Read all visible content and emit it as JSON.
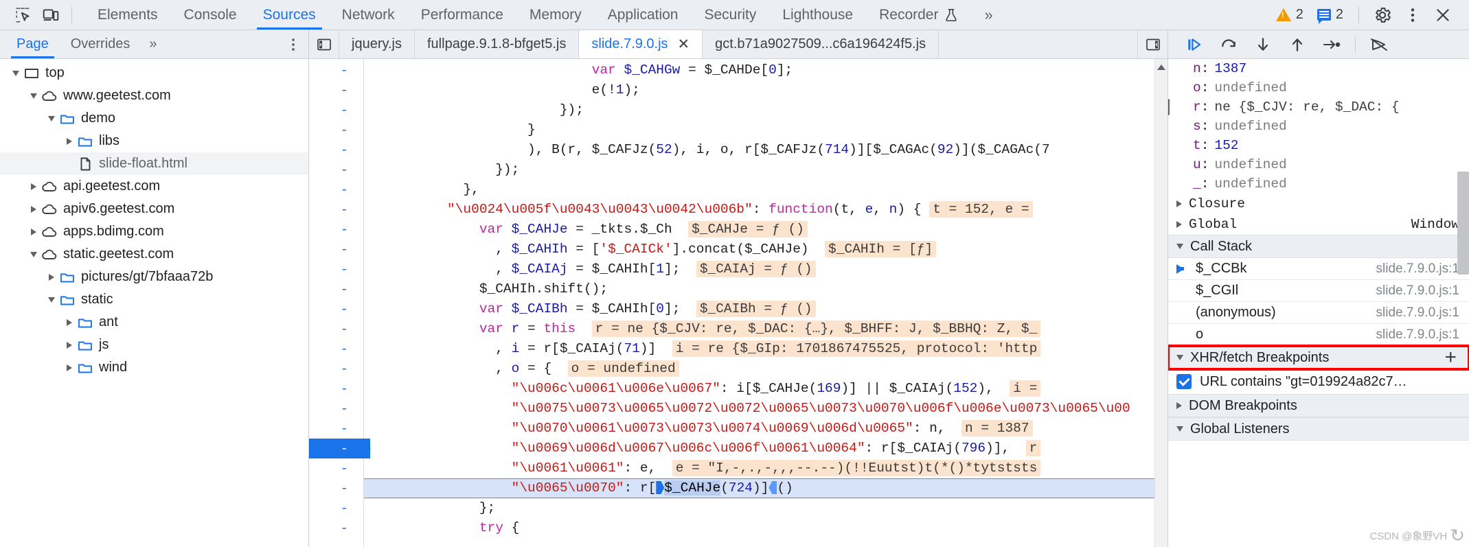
{
  "toolbar": {
    "inspect_icon": "inspect-element-icon",
    "device_icon": "device-toolbar-icon",
    "panels": [
      {
        "label": "Elements",
        "active": false
      },
      {
        "label": "Console",
        "active": false
      },
      {
        "label": "Sources",
        "active": true
      },
      {
        "label": "Network",
        "active": false
      },
      {
        "label": "Performance",
        "active": false
      },
      {
        "label": "Memory",
        "active": false
      },
      {
        "label": "Application",
        "active": false
      },
      {
        "label": "Security",
        "active": false
      },
      {
        "label": "Lighthouse",
        "active": false
      },
      {
        "label": "Recorder",
        "active": false,
        "flask": true
      }
    ],
    "more_panels": "»",
    "warning_count": "2",
    "message_count": "2",
    "settings_icon": "gear-icon",
    "kebab_icon": "more-options-icon",
    "close_icon": "close-icon"
  },
  "navigator": {
    "tabs": [
      {
        "label": "Page",
        "active": true
      },
      {
        "label": "Overrides",
        "active": false
      }
    ],
    "more": "»",
    "kebab_icon": "more-options-icon",
    "tree": [
      {
        "label": "top",
        "indent": 0,
        "twisty": "down",
        "icon": "frame",
        "selected": false
      },
      {
        "label": "www.geetest.com",
        "indent": 1,
        "twisty": "down",
        "icon": "cloud",
        "selected": false
      },
      {
        "label": "demo",
        "indent": 2,
        "twisty": "down",
        "icon": "folder",
        "selected": false
      },
      {
        "label": "libs",
        "indent": 3,
        "twisty": "right",
        "icon": "folder",
        "selected": false
      },
      {
        "label": "slide-float.html",
        "indent": 3,
        "twisty": "none",
        "icon": "file",
        "selected": true
      },
      {
        "label": "api.geetest.com",
        "indent": 1,
        "twisty": "right",
        "icon": "cloud",
        "selected": false
      },
      {
        "label": "apiv6.geetest.com",
        "indent": 1,
        "twisty": "right",
        "icon": "cloud",
        "selected": false
      },
      {
        "label": "apps.bdimg.com",
        "indent": 1,
        "twisty": "right",
        "icon": "cloud",
        "selected": false
      },
      {
        "label": "static.geetest.com",
        "indent": 1,
        "twisty": "down",
        "icon": "cloud",
        "selected": false
      },
      {
        "label": "pictures/gt/7bfaaa72b",
        "indent": 2,
        "twisty": "right",
        "icon": "folder",
        "selected": false
      },
      {
        "label": "static",
        "indent": 2,
        "twisty": "down",
        "icon": "folder",
        "selected": false
      },
      {
        "label": "ant",
        "indent": 3,
        "twisty": "right",
        "icon": "folder",
        "selected": false
      },
      {
        "label": "js",
        "indent": 3,
        "twisty": "right",
        "icon": "folder",
        "selected": false
      },
      {
        "label": "wind",
        "indent": 3,
        "twisty": "right",
        "icon": "folder",
        "selected": false
      }
    ]
  },
  "file_tabs": {
    "panel_toggle_icon": "show-navigator-icon",
    "items": [
      {
        "label": "jquery.js",
        "active": false,
        "closable": false
      },
      {
        "label": "fullpage.9.1.8-bfget5.js",
        "active": false,
        "closable": false
      },
      {
        "label": "slide.7.9.0.js",
        "active": true,
        "closable": true
      },
      {
        "label": "gct.b71a9027509...c6a196424f5.js",
        "active": false,
        "closable": false
      }
    ],
    "close_glyph": "✕",
    "right_toggle_icon": "show-debugger-icon"
  },
  "editor": {
    "gutter_marks": [
      "-",
      "-",
      "-",
      "-",
      "-",
      "-",
      "-",
      "-",
      "-",
      "-",
      "-",
      "-",
      "-",
      "-",
      "-",
      "-",
      "-",
      "-",
      "-",
      "-",
      "-",
      "-",
      "-"
    ],
    "breakpoint_line_index": 19,
    "lines": [
      {
        "indent": 28,
        "tokens": [
          {
            "t": "var ",
            "c": "k"
          },
          {
            "t": "$_CAHGw ",
            "c": "v"
          },
          {
            "t": "= ",
            "c": "p"
          },
          {
            "t": "$_CAHDe[",
            "c": "p"
          },
          {
            "t": "0",
            "c": "n"
          },
          {
            "t": "];",
            "c": "p"
          }
        ]
      },
      {
        "indent": 28,
        "tokens": [
          {
            "t": "e(!",
            "c": "p"
          },
          {
            "t": "1",
            "c": "n"
          },
          {
            "t": ");",
            "c": "p"
          }
        ]
      },
      {
        "indent": 24,
        "tokens": [
          {
            "t": "});",
            "c": "p"
          }
        ]
      },
      {
        "indent": 20,
        "tokens": [
          {
            "t": "}",
            "c": "p"
          }
        ]
      },
      {
        "indent": 20,
        "tokens": [
          {
            "t": "), B(r, $_CAFJz(",
            "c": "p"
          },
          {
            "t": "52",
            "c": "n"
          },
          {
            "t": "), i, o, r[$_CAFJz(",
            "c": "p"
          },
          {
            "t": "714",
            "c": "n"
          },
          {
            "t": ")][$_CAGAc(",
            "c": "p"
          },
          {
            "t": "92",
            "c": "n"
          },
          {
            "t": ")]($_CAGAc(7",
            "c": "p"
          }
        ]
      },
      {
        "indent": 16,
        "tokens": [
          {
            "t": "});",
            "c": "p"
          }
        ]
      },
      {
        "indent": 12,
        "tokens": [
          {
            "t": "},",
            "c": "p"
          }
        ]
      },
      {
        "indent": 10,
        "tokens": [
          {
            "t": "\"\\u0024\\u005f\\u0043\\u0043\\u0042\\u006b\"",
            "c": "s"
          },
          {
            "t": ": ",
            "c": "p"
          },
          {
            "t": "function",
            "c": "k"
          },
          {
            "t": "(t, ",
            "c": "p"
          },
          {
            "t": "e",
            "c": "v"
          },
          {
            "t": ", ",
            "c": "p"
          },
          {
            "t": "n",
            "c": "v"
          },
          {
            "t": ") { ",
            "c": "p"
          },
          {
            "t": "t = 152, e =",
            "c": "iv"
          }
        ]
      },
      {
        "indent": 14,
        "tokens": [
          {
            "t": "var ",
            "c": "k"
          },
          {
            "t": "$_CAHJe ",
            "c": "v"
          },
          {
            "t": "= _tkts.$_Ch  ",
            "c": "p"
          },
          {
            "t": "$_CAHJe = ƒ ()",
            "c": "iv"
          }
        ]
      },
      {
        "indent": 16,
        "tokens": [
          {
            "t": ", ",
            "c": "p"
          },
          {
            "t": "$_CAHIh ",
            "c": "v"
          },
          {
            "t": "= [",
            "c": "p"
          },
          {
            "t": "'$_CAICk'",
            "c": "s"
          },
          {
            "t": "].concat($_CAHJe)  ",
            "c": "p"
          },
          {
            "t": "$_CAHIh = [ƒ]",
            "c": "iv"
          }
        ]
      },
      {
        "indent": 16,
        "tokens": [
          {
            "t": ", ",
            "c": "p"
          },
          {
            "t": "$_CAIAj ",
            "c": "v"
          },
          {
            "t": "= $_CAHIh[",
            "c": "p"
          },
          {
            "t": "1",
            "c": "n"
          },
          {
            "t": "];  ",
            "c": "p"
          },
          {
            "t": "$_CAIAj = ƒ ()",
            "c": "iv"
          }
        ]
      },
      {
        "indent": 14,
        "tokens": [
          {
            "t": "$_CAHIh.shift();",
            "c": "p"
          }
        ]
      },
      {
        "indent": 14,
        "tokens": [
          {
            "t": "var ",
            "c": "k"
          },
          {
            "t": "$_CAIBh ",
            "c": "v"
          },
          {
            "t": "= $_CAHIh[",
            "c": "p"
          },
          {
            "t": "0",
            "c": "n"
          },
          {
            "t": "];  ",
            "c": "p"
          },
          {
            "t": "$_CAIBh = ƒ ()",
            "c": "iv"
          }
        ]
      },
      {
        "indent": 14,
        "tokens": [
          {
            "t": "var ",
            "c": "k"
          },
          {
            "t": "r ",
            "c": "v"
          },
          {
            "t": "= ",
            "c": "p"
          },
          {
            "t": "this",
            "c": "k"
          },
          {
            "t": "  ",
            "c": "p"
          },
          {
            "t": "r = ne {$_CJV: re, $_DAC: {…}, $_BHFF: J, $_BBHQ: Z, $_",
            "c": "iv"
          }
        ]
      },
      {
        "indent": 16,
        "tokens": [
          {
            "t": ", ",
            "c": "p"
          },
          {
            "t": "i ",
            "c": "v"
          },
          {
            "t": "= r[$_CAIAj(",
            "c": "p"
          },
          {
            "t": "71",
            "c": "n"
          },
          {
            "t": ")]  ",
            "c": "p"
          },
          {
            "t": "i = re {$_GIp: 1701867475525, protocol: 'http",
            "c": "iv"
          }
        ]
      },
      {
        "indent": 16,
        "tokens": [
          {
            "t": ", ",
            "c": "p"
          },
          {
            "t": "o ",
            "c": "v"
          },
          {
            "t": "= {  ",
            "c": "p"
          },
          {
            "t": "o = undefined",
            "c": "iv"
          }
        ]
      },
      {
        "indent": 18,
        "tokens": [
          {
            "t": "\"\\u006c\\u0061\\u006e\\u0067\"",
            "c": "s"
          },
          {
            "t": ": i[$_CAHJe(",
            "c": "p"
          },
          {
            "t": "169",
            "c": "n"
          },
          {
            "t": ")] || $_CAIAj(",
            "c": "p"
          },
          {
            "t": "152",
            "c": "n"
          },
          {
            "t": "),  ",
            "c": "p"
          },
          {
            "t": "i =",
            "c": "iv"
          }
        ]
      },
      {
        "indent": 18,
        "tokens": [
          {
            "t": "\"\\u0075\\u0073\\u0065\\u0072\\u0072\\u0065\\u0073\\u0070\\u006f\\u006e\\u0073\\u0065\\u00",
            "c": "s"
          }
        ]
      },
      {
        "indent": 18,
        "tokens": [
          {
            "t": "\"\\u0070\\u0061\\u0073\\u0073\\u0074\\u0069\\u006d\\u0065\"",
            "c": "s"
          },
          {
            "t": ": n,  ",
            "c": "p"
          },
          {
            "t": "n = 1387",
            "c": "iv"
          }
        ]
      },
      {
        "indent": 18,
        "tokens": [
          {
            "t": "\"\\u0069\\u006d\\u0067\\u006c\\u006f\\u0061\\u0064\"",
            "c": "s"
          },
          {
            "t": ": r[$_CAIAj(",
            "c": "p"
          },
          {
            "t": "796",
            "c": "n"
          },
          {
            "t": ")],  ",
            "c": "p"
          },
          {
            "t": "r",
            "c": "iv"
          }
        ]
      },
      {
        "indent": 18,
        "tokens": [
          {
            "t": "\"\\u0061\\u0061\"",
            "c": "s"
          },
          {
            "t": ": e,  ",
            "c": "p"
          },
          {
            "t": "e = \"I,-,.,-,,,--.--)(!!Euutst)t(*()*tytststs",
            "c": "iv"
          }
        ]
      },
      {
        "indent": 18,
        "current": true,
        "tokens": [
          {
            "t": "\"\\u0065\\u0070\"",
            "c": "s"
          },
          {
            "t": ": r[",
            "c": "p"
          },
          {
            "t": "▸",
            "c": "brk"
          },
          {
            "t": "$_CAHJe",
            "c": "sel"
          },
          {
            "t": "(",
            "c": "p"
          },
          {
            "t": "724",
            "c": "n"
          },
          {
            "t": ")]",
            "c": "p"
          },
          {
            "t": "▸",
            "c": "brkr"
          },
          {
            "t": "()",
            "c": "p"
          }
        ]
      },
      {
        "indent": 14,
        "tokens": [
          {
            "t": "};",
            "c": "p"
          }
        ]
      },
      {
        "indent": 14,
        "tokens": [
          {
            "t": "try",
            "c": "k"
          },
          {
            "t": " {",
            "c": "p"
          }
        ]
      }
    ]
  },
  "debugger": {
    "controls": [
      {
        "name": "resume-button",
        "glyph": "resume"
      },
      {
        "name": "step-over-button",
        "glyph": "step-over"
      },
      {
        "name": "step-into-button",
        "glyph": "step-into"
      },
      {
        "name": "step-out-button",
        "glyph": "step-out"
      },
      {
        "name": "step-button",
        "glyph": "step"
      },
      {
        "name": "deactivate-breakpoints-button",
        "glyph": "deactivate"
      }
    ],
    "scope_vars": [
      {
        "key": "n",
        "value": "1387",
        "kind": "num",
        "twisty": "none"
      },
      {
        "key": "o",
        "value": "undefined",
        "kind": "undef",
        "twisty": "none"
      },
      {
        "key": "r",
        "value": "ne {$_CJV: re, $_DAC: {",
        "kind": "obj",
        "twisty": "right"
      },
      {
        "key": "s",
        "value": "undefined",
        "kind": "undef",
        "twisty": "none"
      },
      {
        "key": "t",
        "value": "152",
        "kind": "num",
        "twisty": "none"
      },
      {
        "key": "u",
        "value": "undefined",
        "kind": "undef",
        "twisty": "none"
      },
      {
        "key": "_",
        "value": "undefined",
        "kind": "undef",
        "twisty": "none"
      }
    ],
    "scope_groups": [
      {
        "label": "Closure",
        "right": "",
        "twisty": "right"
      },
      {
        "label": "Global",
        "right": "Window",
        "twisty": "right"
      }
    ],
    "call_stack_header": "Call Stack",
    "call_stack": [
      {
        "name": "$_CCBk",
        "location": "slide.7.9.0.js:1",
        "active": true
      },
      {
        "name": "$_CGIl",
        "location": "slide.7.9.0.js:1",
        "active": false
      },
      {
        "name": "(anonymous)",
        "location": "slide.7.9.0.js:1",
        "active": false
      },
      {
        "name": "o",
        "location": "slide.7.9.0.js:1",
        "active": false
      }
    ],
    "xhr_header": "XHR/fetch Breakpoints",
    "xhr_add": "+",
    "xhr_items": [
      {
        "label": "URL contains \"gt=019924a82c7…",
        "checked": true
      }
    ],
    "dom_breakpoints_header": "DOM Breakpoints",
    "global_listeners_header": "Global Listeners",
    "watermark": "CSDN @象野VH"
  }
}
